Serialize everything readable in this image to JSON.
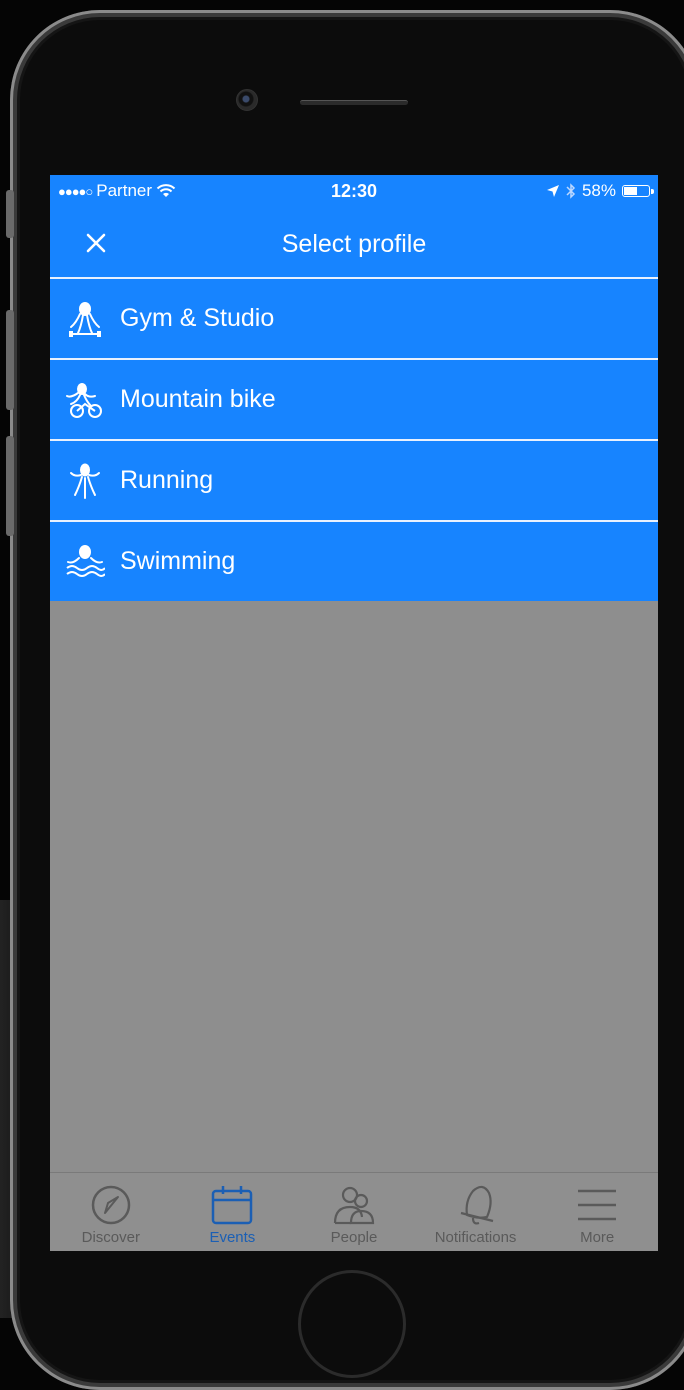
{
  "status_bar": {
    "carrier": "Partner",
    "time": "12:30",
    "battery": "58%",
    "battery_level": 0.58
  },
  "nav": {
    "title": "Select profile",
    "close_icon": "close-icon"
  },
  "profiles": [
    {
      "label": "Gym & Studio",
      "icon": "octopus-gym-icon"
    },
    {
      "label": "Mountain bike",
      "icon": "octopus-bike-icon"
    },
    {
      "label": "Running",
      "icon": "octopus-running-icon"
    },
    {
      "label": "Swimming",
      "icon": "octopus-swimming-icon"
    }
  ],
  "tabs": [
    {
      "label": "Discover",
      "icon": "compass-icon",
      "active": false
    },
    {
      "label": "Events",
      "icon": "calendar-icon",
      "active": true
    },
    {
      "label": "People",
      "icon": "people-icon",
      "active": false
    },
    {
      "label": "Notifications",
      "icon": "bell-icon",
      "active": false
    },
    {
      "label": "More",
      "icon": "menu-icon",
      "active": false
    }
  ],
  "colors": {
    "primary": "#1784ff",
    "overlay": "#8e8e8e",
    "tab_active": "#1b5fb4",
    "tab_inactive": "#5a5a5a"
  }
}
